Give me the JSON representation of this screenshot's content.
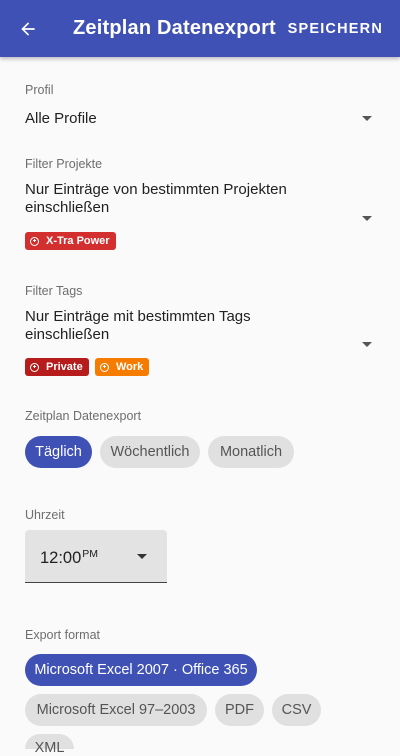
{
  "appbar": {
    "title": "Zeitplan Datenexport",
    "save_label": "SPEICHERN",
    "back_icon": "arrow-back-icon"
  },
  "profile": {
    "label": "Profil",
    "value": "Alle Profile"
  },
  "filter_projects": {
    "label": "Filter Projekte",
    "value_line1": "Nur Einträge von bestimmten Projekten",
    "value_line2": "einschließen",
    "tags": [
      {
        "label": "X-Tra Power",
        "color": "#d32f2f"
      }
    ]
  },
  "filter_tags": {
    "label": "Filter Tags",
    "value_line1": "Nur Einträge mit bestimmten Tags",
    "value_line2": "einschließen",
    "tags": [
      {
        "label": "Private",
        "color": "#b71c1c"
      },
      {
        "label": "Work",
        "color": "#f57c00"
      }
    ]
  },
  "schedule": {
    "label": "Zeitplan Datenexport",
    "options": [
      {
        "label": "Täglich",
        "selected": true
      },
      {
        "label": "Wöchentlich",
        "selected": false
      },
      {
        "label": "Monatlich",
        "selected": false
      }
    ]
  },
  "time": {
    "label": "Uhrzeit",
    "value": "12:00",
    "ampm": "PM"
  },
  "export_format": {
    "label": "Export format",
    "options": [
      {
        "label": "Microsoft Excel 2007 · Office 365",
        "selected": true
      },
      {
        "label": "Microsoft Excel 97–2003",
        "selected": false
      },
      {
        "label": "PDF",
        "selected": false
      },
      {
        "label": "CSV",
        "selected": false
      },
      {
        "label": "XML",
        "selected": false
      }
    ]
  },
  "colors": {
    "primary": "#3f51b5",
    "chip_inactive": "#e0e0e0"
  }
}
